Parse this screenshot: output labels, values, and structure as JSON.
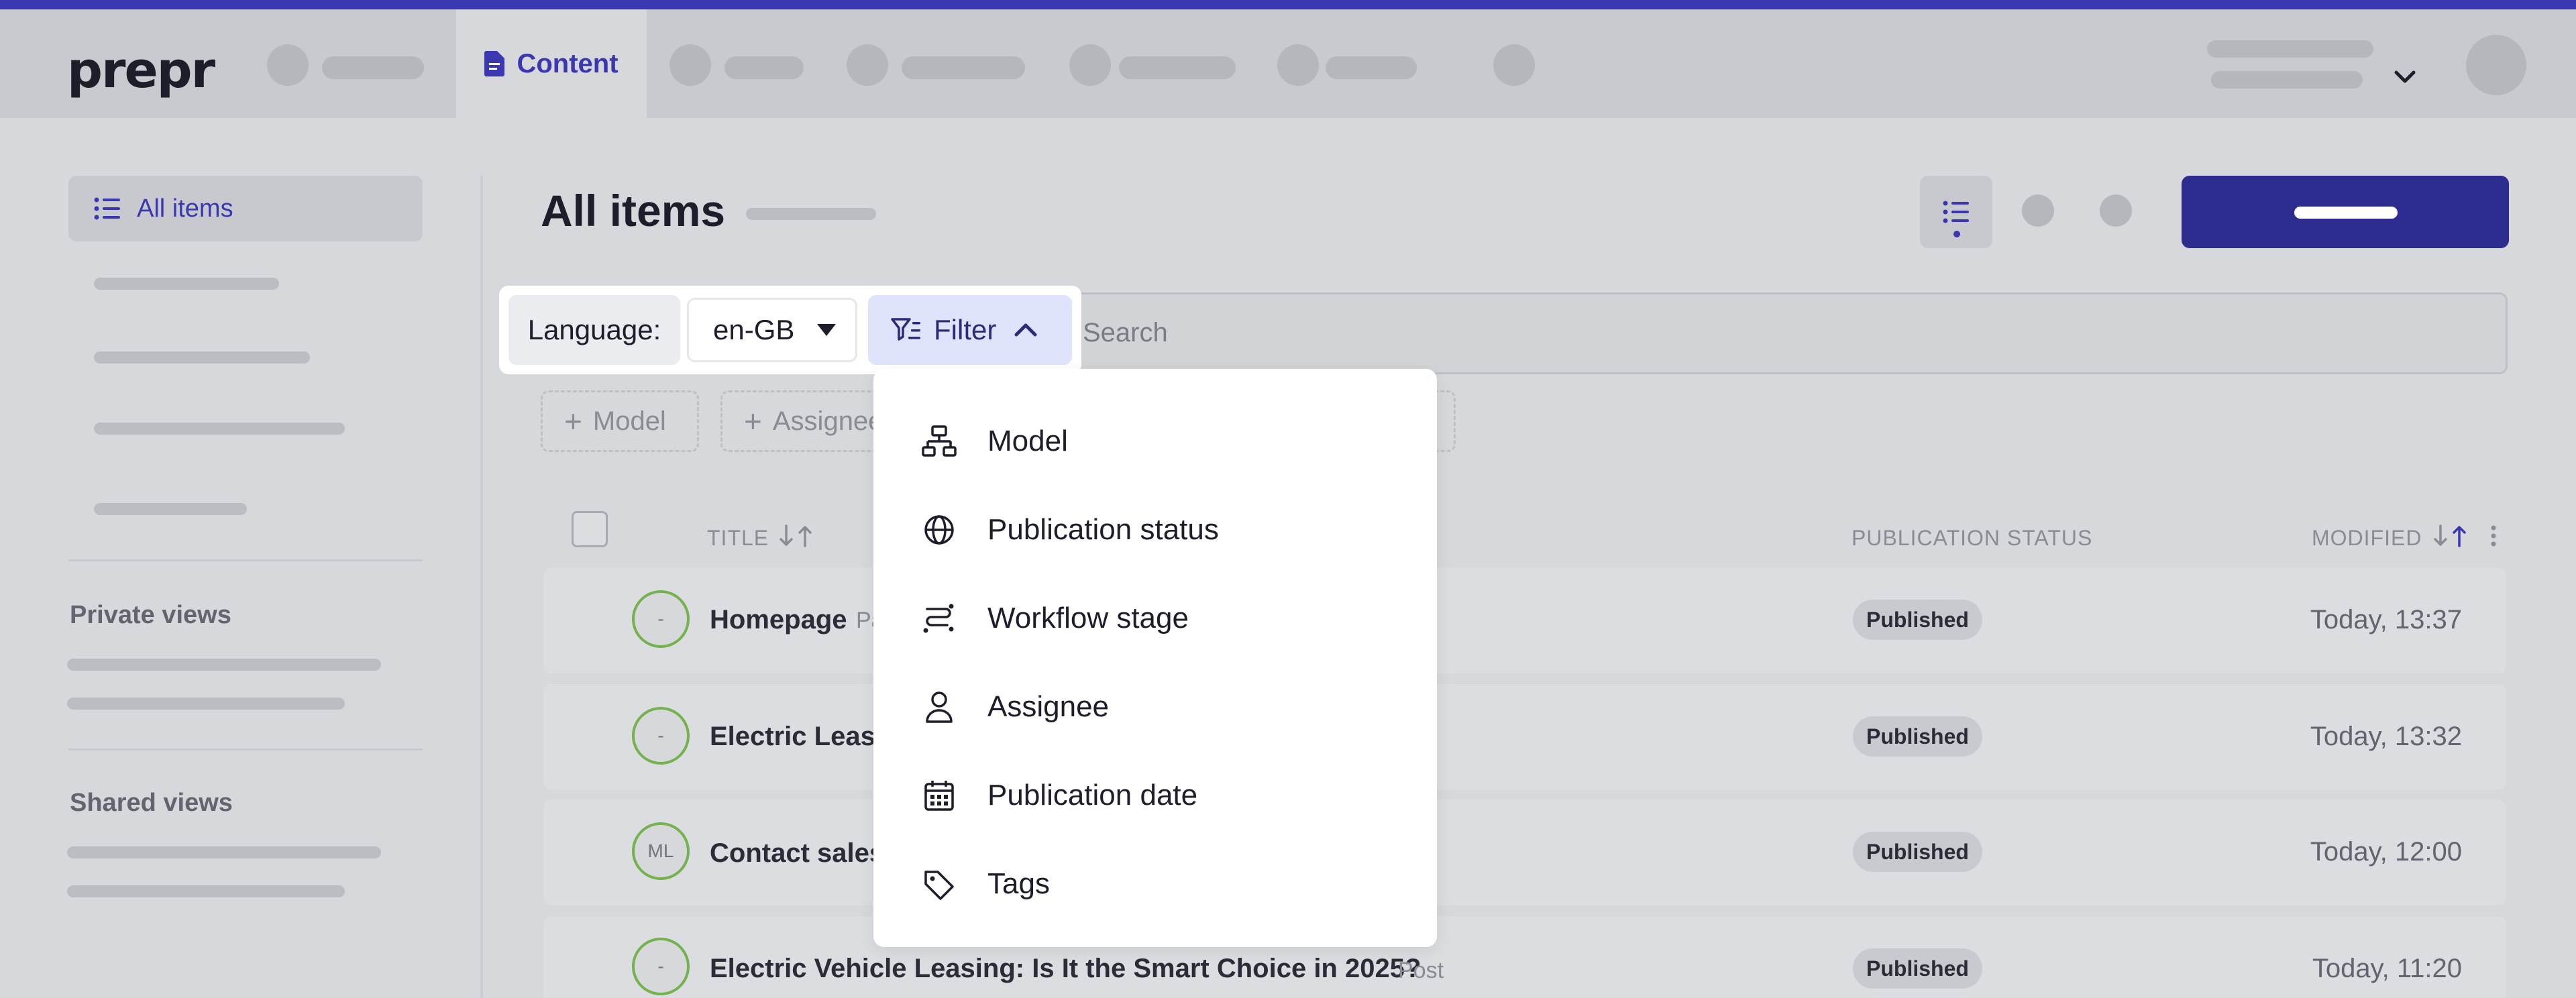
{
  "app": {
    "logo": "prepr",
    "active_tab": "Content"
  },
  "sidebar": {
    "active_item": "All items",
    "private_views": "Private views",
    "shared_views": "Shared views"
  },
  "main": {
    "title": "All items",
    "language_label": "Language:",
    "language_value": "en-GB",
    "filter_label": "Filter",
    "search_placeholder": "Search",
    "chips": [
      "Model",
      "Assignee"
    ]
  },
  "table": {
    "headers": {
      "title": "TITLE",
      "publication_status": "PUBLICATION STATUS",
      "modified": "MODIFIED"
    },
    "rows": [
      {
        "avatar": "-",
        "title": "Homepage",
        "type": "Page",
        "status": "Published",
        "modified": "Today, 13:37"
      },
      {
        "avatar": "-",
        "title": "Electric Leasing",
        "type": "",
        "status": "Published",
        "modified": "Today, 13:32"
      },
      {
        "avatar": "ML",
        "title": "Contact sales",
        "type": "",
        "status": "Published",
        "modified": "Today, 12:00"
      },
      {
        "avatar": "-",
        "title": "Electric Vehicle Leasing: Is It the Smart Choice in 2025?",
        "type": "Post",
        "status": "Published",
        "modified": "Today, 11:20"
      }
    ]
  },
  "filter_menu": {
    "items": [
      {
        "label": "Model",
        "icon": "model-tree-icon"
      },
      {
        "label": "Publication status",
        "icon": "globe-icon"
      },
      {
        "label": "Workflow stage",
        "icon": "workflow-icon"
      },
      {
        "label": "Assignee",
        "icon": "person-icon"
      },
      {
        "label": "Publication date",
        "icon": "calendar-icon"
      },
      {
        "label": "Tags",
        "icon": "tag-icon"
      }
    ]
  },
  "colors": {
    "accent": "#3a37b0",
    "primary_button": "#2c2c8e",
    "published_avatar_ring": "#74b24e"
  }
}
